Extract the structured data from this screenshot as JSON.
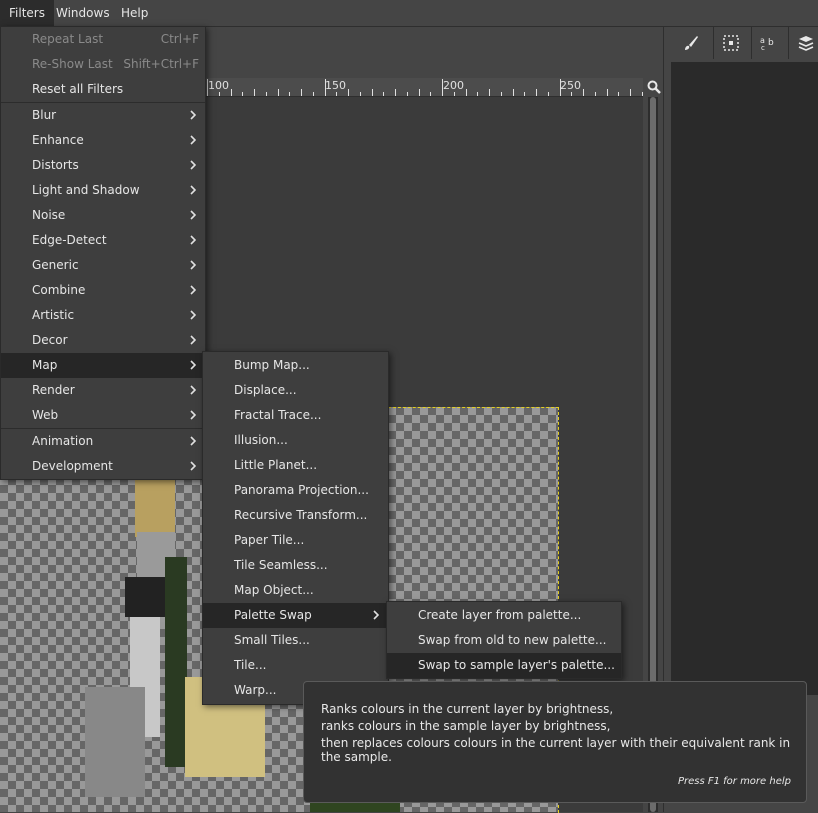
{
  "menubar": {
    "items": [
      {
        "label": "Filters"
      },
      {
        "label": "Windows"
      },
      {
        "label": "Help"
      }
    ]
  },
  "ruler": {
    "labels": [
      "100",
      "150",
      "200",
      "250"
    ]
  },
  "filters_menu": {
    "repeat_last": {
      "label": "Repeat Last",
      "shortcut": "Ctrl+F"
    },
    "reshow_last": {
      "label": "Re-Show Last",
      "shortcut": "Shift+Ctrl+F"
    },
    "reset_all": {
      "label": "Reset all Filters"
    },
    "submenus": [
      "Blur",
      "Enhance",
      "Distorts",
      "Light and Shadow",
      "Noise",
      "Edge-Detect",
      "Generic",
      "Combine",
      "Artistic",
      "Decor",
      "Map",
      "Render",
      "Web"
    ],
    "submenus2": [
      "Animation",
      "Development"
    ],
    "highlighted": "Map"
  },
  "map_menu": {
    "items": [
      "Bump Map...",
      "Displace...",
      "Fractal Trace...",
      "Illusion...",
      "Little Planet...",
      "Panorama Projection...",
      "Recursive Transform...",
      "Paper Tile...",
      "Tile Seamless...",
      "Map Object...",
      "Palette Swap",
      "Small Tiles...",
      "Tile...",
      "Warp..."
    ],
    "highlighted": "Palette Swap"
  },
  "palette_menu": {
    "items": [
      "Create layer from palette...",
      "Swap from old to new palette...",
      "Swap to sample layer's palette..."
    ],
    "highlighted": "Swap to sample layer's palette..."
  },
  "tooltip": {
    "lines": [
      "Ranks colours in the current layer by brightness,",
      "ranks colours in the sample layer by brightness,",
      "then replaces colours colours in the current layer with their equivalent rank in the sample."
    ],
    "help": "Press F1 for more help"
  },
  "dock": {
    "tabs": [
      "brush-icon",
      "pattern-icon",
      "text-icon",
      "layers-icon"
    ]
  },
  "colors": {
    "menu_bg": "#3e3e3e",
    "highlight": "#262626",
    "canvas_bg": "#3b3b3b",
    "layer_boundary": "#e5d020"
  }
}
